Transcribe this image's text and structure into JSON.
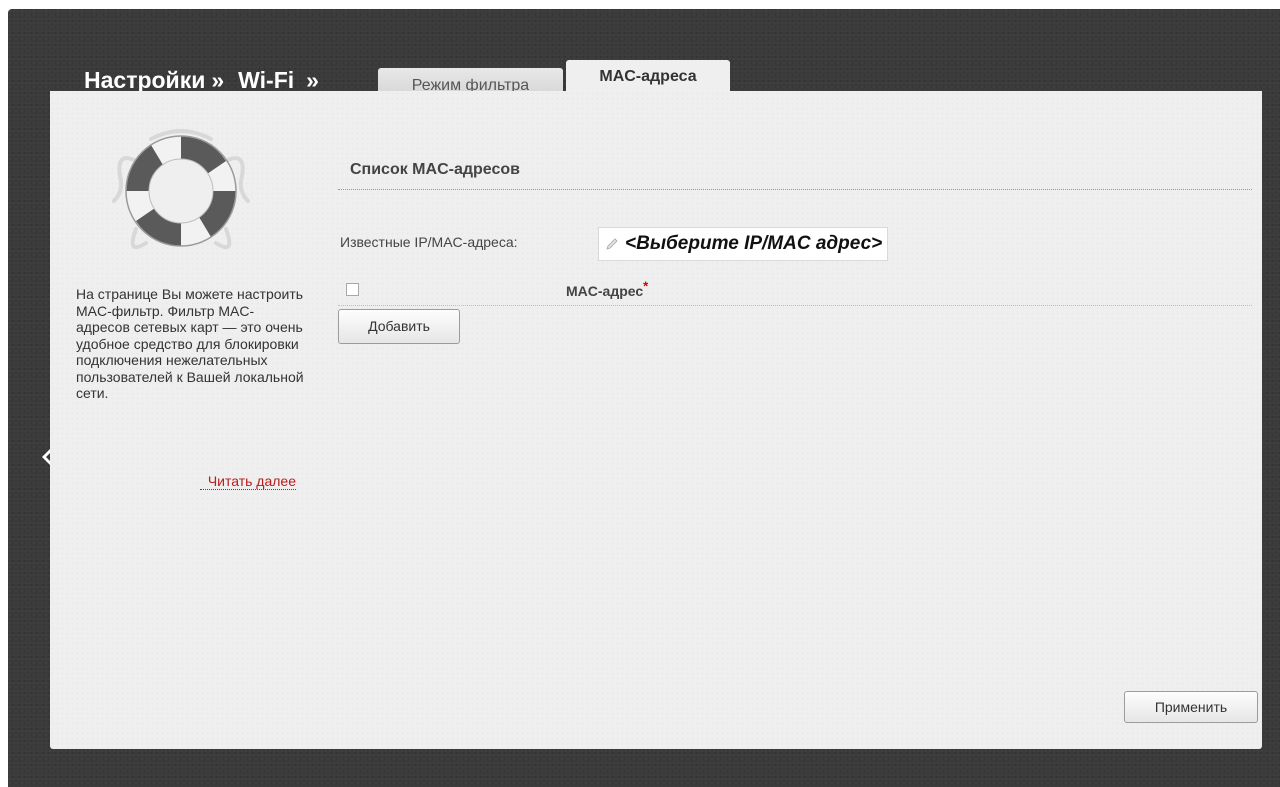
{
  "breadcrumb": {
    "root": "Настройки",
    "separator": "»",
    "section": "Wi-Fi"
  },
  "tabs": [
    {
      "label": "Режим фильтра",
      "active": false
    },
    {
      "label": "MAC-адреса",
      "active": true
    }
  ],
  "help": {
    "icon": "lifebuoy-icon",
    "text": "На странице Вы можете настроить MAC-фильтр. Фильтр MAC-адресов сетевых карт — это очень удобное средство для блокировки подключения нежелательных пользователей к Вашей локальной сети.",
    "read_more": "Читать далее"
  },
  "main": {
    "section_title": "Список MAC-адресов",
    "known_label": "Известные IP/MAC-адреса:",
    "known_select_placeholder": "<Выберите IP/MAC адрес>",
    "column_mac": "MAC-адрес",
    "required_mark": "*",
    "select_all_checked": false,
    "add_button": "Добавить",
    "apply_button": "Применить"
  },
  "colors": {
    "frame": "#3a3a3a",
    "panel": "#efefef",
    "link": "#b81c1c",
    "required": "#d40000"
  }
}
